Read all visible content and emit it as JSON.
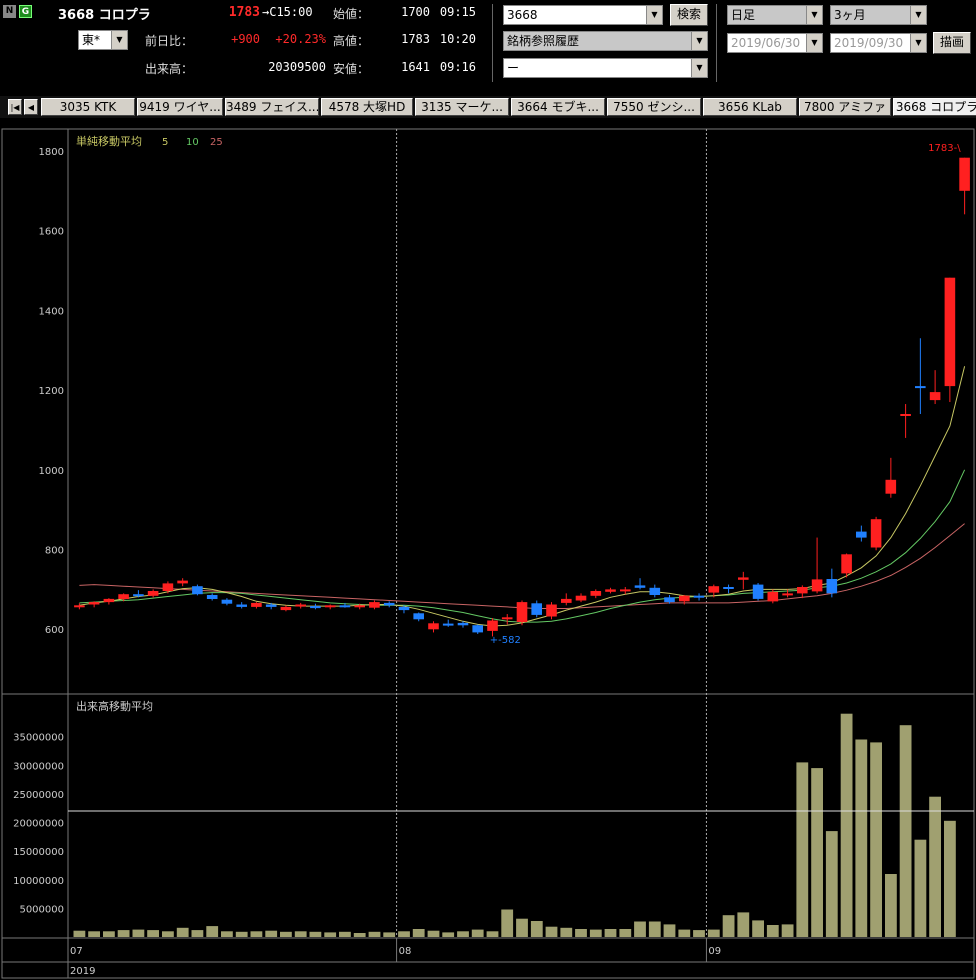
{
  "header": {
    "badge_n": "N",
    "badge_g": "G",
    "title": "3668 コロプラ",
    "price": "1783",
    "time": "→C15:00",
    "market": "東*",
    "change_label": "前日比：",
    "change": "+900",
    "change_pct": "+20.23%",
    "volume_label": "出来高：",
    "volume": "20309500",
    "open_label": "始値：",
    "open": "1700",
    "open_time": "09:15",
    "high_label": "高値：",
    "high": "1783",
    "high_time": "10:20",
    "low_label": "安値：",
    "low": "1641",
    "low_time": "09:16"
  },
  "search": {
    "code": "3668",
    "search_button": "検索",
    "history": "銘柄参照履歴",
    "third": "ー"
  },
  "period": {
    "interval": "日足",
    "range": "3ヶ月",
    "date_from": "2019/06/30",
    "date_to": "2019/09/30",
    "draw_button": "描画"
  },
  "tabs": [
    "3035 KTK",
    "9419 ワイヤ...",
    "3489 フェイス...",
    "4578 大塚HD",
    "3135 マーケ...",
    "3664 モブキ...",
    "7550 ゼンシ...",
    "3656 KLab",
    "7800 アミファ",
    "3668 コロプラ"
  ],
  "selected_tab": 9,
  "chart_data": {
    "type": "candlestick",
    "price_panel": {
      "legend_title": "単純移動平均",
      "ma_periods": [
        "5",
        "10",
        "25"
      ],
      "ma_colors": [
        "#c8c864",
        "#64c864",
        "#c86464"
      ],
      "y_ticks": [
        600,
        800,
        1000,
        1200,
        1400,
        1600,
        1800
      ],
      "ylim": [
        440,
        1840
      ],
      "max_label": "1783",
      "min_label": "582",
      "up_color": "#ff2020",
      "down_color": "#2080ff"
    },
    "volume_panel": {
      "legend_title": "出来高移動平均",
      "y_ticks": [
        5000000,
        10000000,
        15000000,
        20000000,
        25000000,
        30000000,
        35000000
      ],
      "ylim": [
        0,
        40000000
      ],
      "average_line": 22000000,
      "bar_color": "#a0a070"
    },
    "x_labels": [
      "07",
      "08",
      "09"
    ],
    "year_label": "2019",
    "candles": [
      {
        "o": 655,
        "h": 665,
        "l": 650,
        "c": 660
      },
      {
        "o": 662,
        "h": 670,
        "l": 655,
        "c": 668
      },
      {
        "o": 668,
        "h": 678,
        "l": 662,
        "c": 676
      },
      {
        "o": 676,
        "h": 690,
        "l": 670,
        "c": 688
      },
      {
        "o": 688,
        "h": 698,
        "l": 680,
        "c": 684
      },
      {
        "o": 684,
        "h": 700,
        "l": 680,
        "c": 696
      },
      {
        "o": 696,
        "h": 720,
        "l": 690,
        "c": 715
      },
      {
        "o": 715,
        "h": 728,
        "l": 708,
        "c": 722
      },
      {
        "o": 708,
        "h": 712,
        "l": 685,
        "c": 688
      },
      {
        "o": 686,
        "h": 690,
        "l": 672,
        "c": 676
      },
      {
        "o": 674,
        "h": 678,
        "l": 660,
        "c": 664
      },
      {
        "o": 662,
        "h": 668,
        "l": 652,
        "c": 656
      },
      {
        "o": 656,
        "h": 668,
        "l": 652,
        "c": 666
      },
      {
        "o": 662,
        "h": 666,
        "l": 650,
        "c": 656
      },
      {
        "o": 648,
        "h": 660,
        "l": 645,
        "c": 656
      },
      {
        "o": 660,
        "h": 666,
        "l": 652,
        "c": 662
      },
      {
        "o": 658,
        "h": 664,
        "l": 650,
        "c": 656
      },
      {
        "o": 656,
        "h": 662,
        "l": 650,
        "c": 660
      },
      {
        "o": 660,
        "h": 666,
        "l": 654,
        "c": 658
      },
      {
        "o": 656,
        "h": 664,
        "l": 650,
        "c": 660
      },
      {
        "o": 654,
        "h": 672,
        "l": 650,
        "c": 668
      },
      {
        "o": 666,
        "h": 670,
        "l": 655,
        "c": 660
      },
      {
        "o": 656,
        "h": 660,
        "l": 640,
        "c": 648
      },
      {
        "o": 640,
        "h": 642,
        "l": 620,
        "c": 625
      },
      {
        "o": 600,
        "h": 620,
        "l": 592,
        "c": 615
      },
      {
        "o": 614,
        "h": 624,
        "l": 606,
        "c": 612
      },
      {
        "o": 616,
        "h": 620,
        "l": 604,
        "c": 610
      },
      {
        "o": 610,
        "h": 612,
        "l": 588,
        "c": 592
      },
      {
        "o": 596,
        "h": 628,
        "l": 582,
        "c": 622
      },
      {
        "o": 625,
        "h": 638,
        "l": 612,
        "c": 630
      },
      {
        "o": 618,
        "h": 672,
        "l": 610,
        "c": 668
      },
      {
        "o": 665,
        "h": 672,
        "l": 630,
        "c": 636
      },
      {
        "o": 632,
        "h": 668,
        "l": 625,
        "c": 662
      },
      {
        "o": 666,
        "h": 690,
        "l": 660,
        "c": 676
      },
      {
        "o": 672,
        "h": 690,
        "l": 668,
        "c": 684
      },
      {
        "o": 684,
        "h": 700,
        "l": 678,
        "c": 696
      },
      {
        "o": 694,
        "h": 704,
        "l": 690,
        "c": 700
      },
      {
        "o": 696,
        "h": 706,
        "l": 688,
        "c": 700
      },
      {
        "o": 710,
        "h": 728,
        "l": 700,
        "c": 704
      },
      {
        "o": 704,
        "h": 712,
        "l": 680,
        "c": 686
      },
      {
        "o": 680,
        "h": 686,
        "l": 664,
        "c": 668
      },
      {
        "o": 670,
        "h": 686,
        "l": 662,
        "c": 684
      },
      {
        "o": 684,
        "h": 690,
        "l": 672,
        "c": 680
      },
      {
        "o": 692,
        "h": 712,
        "l": 680,
        "c": 708
      },
      {
        "o": 706,
        "h": 712,
        "l": 690,
        "c": 702
      },
      {
        "o": 724,
        "h": 744,
        "l": 700,
        "c": 730
      },
      {
        "o": 712,
        "h": 716,
        "l": 672,
        "c": 676
      },
      {
        "o": 670,
        "h": 700,
        "l": 665,
        "c": 694
      },
      {
        "o": 688,
        "h": 700,
        "l": 680,
        "c": 690
      },
      {
        "o": 690,
        "h": 710,
        "l": 678,
        "c": 706
      },
      {
        "o": 695,
        "h": 830,
        "l": 690,
        "c": 725
      },
      {
        "o": 726,
        "h": 752,
        "l": 680,
        "c": 690
      },
      {
        "o": 740,
        "h": 790,
        "l": 730,
        "c": 788
      },
      {
        "o": 845,
        "h": 860,
        "l": 820,
        "c": 830
      },
      {
        "o": 805,
        "h": 882,
        "l": 798,
        "c": 876
      },
      {
        "o": 940,
        "h": 1030,
        "l": 930,
        "c": 975
      },
      {
        "o": 1135,
        "h": 1165,
        "l": 1080,
        "c": 1140
      },
      {
        "o": 1210,
        "h": 1330,
        "l": 1140,
        "c": 1205
      },
      {
        "o": 1175,
        "h": 1250,
        "l": 1165,
        "c": 1195
      },
      {
        "o": 1210,
        "h": 1482,
        "l": 1170,
        "c": 1482
      },
      {
        "o": 1700,
        "h": 1783,
        "l": 1641,
        "c": 1783
      }
    ],
    "ma5": [
      660,
      666,
      670,
      676,
      682,
      686,
      694,
      702,
      704,
      700,
      692,
      682,
      670,
      664,
      660,
      658,
      658,
      658,
      658,
      660,
      662,
      662,
      658,
      650,
      640,
      630,
      620,
      612,
      608,
      610,
      616,
      626,
      636,
      648,
      658,
      668,
      680,
      688,
      694,
      694,
      690,
      684,
      682,
      684,
      688,
      696,
      700,
      700,
      700,
      702,
      710,
      716,
      734,
      754,
      784,
      830,
      890,
      960,
      1035,
      1110,
      1260
    ],
    "ma10": [
      666,
      668,
      670,
      672,
      674,
      678,
      682,
      686,
      690,
      692,
      692,
      690,
      686,
      682,
      678,
      674,
      670,
      666,
      664,
      662,
      660,
      660,
      660,
      658,
      654,
      648,
      642,
      634,
      626,
      620,
      618,
      618,
      620,
      626,
      634,
      642,
      652,
      660,
      668,
      674,
      678,
      680,
      682,
      684,
      686,
      690,
      692,
      694,
      696,
      698,
      704,
      708,
      716,
      728,
      744,
      764,
      792,
      828,
      870,
      920,
      1000
    ],
    "ma25": [
      710,
      712,
      710,
      708,
      706,
      704,
      702,
      700,
      698,
      696,
      694,
      692,
      690,
      688,
      686,
      684,
      682,
      680,
      678,
      676,
      674,
      672,
      670,
      668,
      666,
      664,
      662,
      660,
      658,
      656,
      654,
      652,
      652,
      652,
      654,
      656,
      658,
      660,
      662,
      664,
      666,
      666,
      666,
      666,
      666,
      668,
      670,
      672,
      676,
      680,
      684,
      690,
      698,
      708,
      720,
      735,
      755,
      778,
      805,
      835,
      865
    ],
    "volumes": [
      1100000,
      1000000,
      1000000,
      1200000,
      1300000,
      1200000,
      1000000,
      1600000,
      1200000,
      1900000,
      1000000,
      900000,
      1000000,
      1100000,
      900000,
      1000000,
      900000,
      800000,
      900000,
      700000,
      900000,
      800000,
      1000000,
      1400000,
      1100000,
      800000,
      1000000,
      1300000,
      1000000,
      4800000,
      3200000,
      2800000,
      1800000,
      1600000,
      1400000,
      1300000,
      1400000,
      1400000,
      2700000,
      2700000,
      2200000,
      1300000,
      1200000,
      1300000,
      3800000,
      4300000,
      2900000,
      2100000,
      2200000,
      30500000,
      29500000,
      18500000,
      39000000,
      34500000,
      34000000,
      11000000,
      37000000,
      17000000,
      24500000,
      20300000
    ]
  }
}
